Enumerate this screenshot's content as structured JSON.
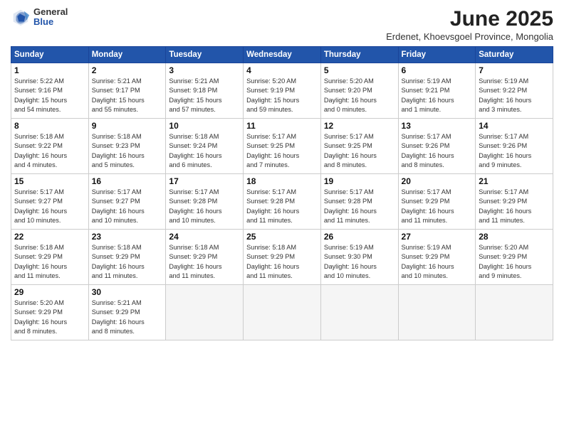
{
  "logo": {
    "general": "General",
    "blue": "Blue"
  },
  "title": "June 2025",
  "location": "Erdenet, Khoevsgoel Province, Mongolia",
  "days_of_week": [
    "Sunday",
    "Monday",
    "Tuesday",
    "Wednesday",
    "Thursday",
    "Friday",
    "Saturday"
  ],
  "weeks": [
    [
      {
        "day": "1",
        "info": "Sunrise: 5:22 AM\nSunset: 9:16 PM\nDaylight: 15 hours\nand 54 minutes."
      },
      {
        "day": "2",
        "info": "Sunrise: 5:21 AM\nSunset: 9:17 PM\nDaylight: 15 hours\nand 55 minutes."
      },
      {
        "day": "3",
        "info": "Sunrise: 5:21 AM\nSunset: 9:18 PM\nDaylight: 15 hours\nand 57 minutes."
      },
      {
        "day": "4",
        "info": "Sunrise: 5:20 AM\nSunset: 9:19 PM\nDaylight: 15 hours\nand 59 minutes."
      },
      {
        "day": "5",
        "info": "Sunrise: 5:20 AM\nSunset: 9:20 PM\nDaylight: 16 hours\nand 0 minutes."
      },
      {
        "day": "6",
        "info": "Sunrise: 5:19 AM\nSunset: 9:21 PM\nDaylight: 16 hours\nand 1 minute."
      },
      {
        "day": "7",
        "info": "Sunrise: 5:19 AM\nSunset: 9:22 PM\nDaylight: 16 hours\nand 3 minutes."
      }
    ],
    [
      {
        "day": "8",
        "info": "Sunrise: 5:18 AM\nSunset: 9:22 PM\nDaylight: 16 hours\nand 4 minutes."
      },
      {
        "day": "9",
        "info": "Sunrise: 5:18 AM\nSunset: 9:23 PM\nDaylight: 16 hours\nand 5 minutes."
      },
      {
        "day": "10",
        "info": "Sunrise: 5:18 AM\nSunset: 9:24 PM\nDaylight: 16 hours\nand 6 minutes."
      },
      {
        "day": "11",
        "info": "Sunrise: 5:17 AM\nSunset: 9:25 PM\nDaylight: 16 hours\nand 7 minutes."
      },
      {
        "day": "12",
        "info": "Sunrise: 5:17 AM\nSunset: 9:25 PM\nDaylight: 16 hours\nand 8 minutes."
      },
      {
        "day": "13",
        "info": "Sunrise: 5:17 AM\nSunset: 9:26 PM\nDaylight: 16 hours\nand 8 minutes."
      },
      {
        "day": "14",
        "info": "Sunrise: 5:17 AM\nSunset: 9:26 PM\nDaylight: 16 hours\nand 9 minutes."
      }
    ],
    [
      {
        "day": "15",
        "info": "Sunrise: 5:17 AM\nSunset: 9:27 PM\nDaylight: 16 hours\nand 10 minutes."
      },
      {
        "day": "16",
        "info": "Sunrise: 5:17 AM\nSunset: 9:27 PM\nDaylight: 16 hours\nand 10 minutes."
      },
      {
        "day": "17",
        "info": "Sunrise: 5:17 AM\nSunset: 9:28 PM\nDaylight: 16 hours\nand 10 minutes."
      },
      {
        "day": "18",
        "info": "Sunrise: 5:17 AM\nSunset: 9:28 PM\nDaylight: 16 hours\nand 11 minutes."
      },
      {
        "day": "19",
        "info": "Sunrise: 5:17 AM\nSunset: 9:28 PM\nDaylight: 16 hours\nand 11 minutes."
      },
      {
        "day": "20",
        "info": "Sunrise: 5:17 AM\nSunset: 9:29 PM\nDaylight: 16 hours\nand 11 minutes."
      },
      {
        "day": "21",
        "info": "Sunrise: 5:17 AM\nSunset: 9:29 PM\nDaylight: 16 hours\nand 11 minutes."
      }
    ],
    [
      {
        "day": "22",
        "info": "Sunrise: 5:18 AM\nSunset: 9:29 PM\nDaylight: 16 hours\nand 11 minutes."
      },
      {
        "day": "23",
        "info": "Sunrise: 5:18 AM\nSunset: 9:29 PM\nDaylight: 16 hours\nand 11 minutes."
      },
      {
        "day": "24",
        "info": "Sunrise: 5:18 AM\nSunset: 9:29 PM\nDaylight: 16 hours\nand 11 minutes."
      },
      {
        "day": "25",
        "info": "Sunrise: 5:18 AM\nSunset: 9:29 PM\nDaylight: 16 hours\nand 11 minutes."
      },
      {
        "day": "26",
        "info": "Sunrise: 5:19 AM\nSunset: 9:30 PM\nDaylight: 16 hours\nand 10 minutes."
      },
      {
        "day": "27",
        "info": "Sunrise: 5:19 AM\nSunset: 9:29 PM\nDaylight: 16 hours\nand 10 minutes."
      },
      {
        "day": "28",
        "info": "Sunrise: 5:20 AM\nSunset: 9:29 PM\nDaylight: 16 hours\nand 9 minutes."
      }
    ],
    [
      {
        "day": "29",
        "info": "Sunrise: 5:20 AM\nSunset: 9:29 PM\nDaylight: 16 hours\nand 8 minutes."
      },
      {
        "day": "30",
        "info": "Sunrise: 5:21 AM\nSunset: 9:29 PM\nDaylight: 16 hours\nand 8 minutes."
      },
      {
        "day": "",
        "info": ""
      },
      {
        "day": "",
        "info": ""
      },
      {
        "day": "",
        "info": ""
      },
      {
        "day": "",
        "info": ""
      },
      {
        "day": "",
        "info": ""
      }
    ]
  ]
}
